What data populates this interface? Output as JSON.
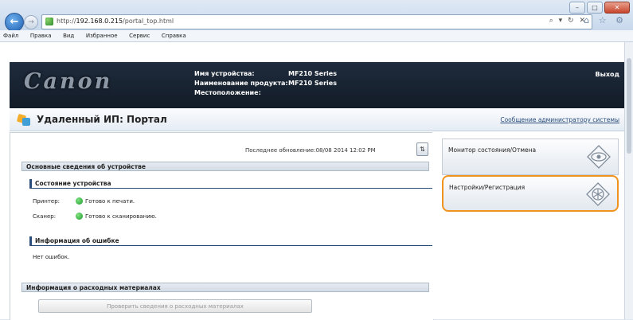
{
  "browser": {
    "url": "http://192.168.0.215/portal_top.html",
    "url_host": "192.168.0.215",
    "url_prefix": "http://",
    "url_path": "/portal_top.html",
    "address_tools": "⌕ ▾ ↻ ✕",
    "toolbar_icons": "⌂ ☆ ⚙",
    "window_buttons": {
      "minimize": "–",
      "maximize": "□",
      "close": "✕"
    },
    "back_glyph": "←",
    "forward_glyph": "→",
    "menu": [
      "Файл",
      "Правка",
      "Вид",
      "Избранное",
      "Сервис",
      "Справка"
    ]
  },
  "header": {
    "logo_text": "Canon",
    "device_name_label": "Имя устройства:",
    "device_name_value": "MF210 Series",
    "product_name_label": "Наименование продукта:",
    "product_name_value": "MF210 Series",
    "location_label": "Местоположение:",
    "location_value": "",
    "logout_label": "Выход"
  },
  "portal": {
    "title": "Удаленный ИП: Портал",
    "admin_message_link": "Сообщение администратору системы"
  },
  "main": {
    "last_update_text": "Последнее обновление:08/08 2014 12:02 PM",
    "refresh_glyph": "⇅",
    "basic_info_title": "Основные сведения об устройстве",
    "device_status_title": "Состояние устройства",
    "printer_label": "Принтер:",
    "printer_status": "Готово к печати.",
    "scanner_label": "Сканер:",
    "scanner_status": "Готово к сканированию.",
    "error_info_title": "Информация об ошибке",
    "error_text": "Нет ошибок.",
    "consumables_title": "Информация о расходных материалах",
    "consumables_button": "Проверить сведения о расходных материалах"
  },
  "side": {
    "status_monitor_label": "Монитор состояния/Отмена",
    "settings_label": "Настройки/Регистрация"
  },
  "colors": {
    "header_bg": "#1a2533",
    "highlight_border": "#f0931e",
    "status_green": "#2fae3b",
    "link_blue": "#2b4d7a"
  },
  "icons": {
    "status_monitor": "eye-diamond-icon",
    "settings": "asterisk-diamond-icon"
  }
}
